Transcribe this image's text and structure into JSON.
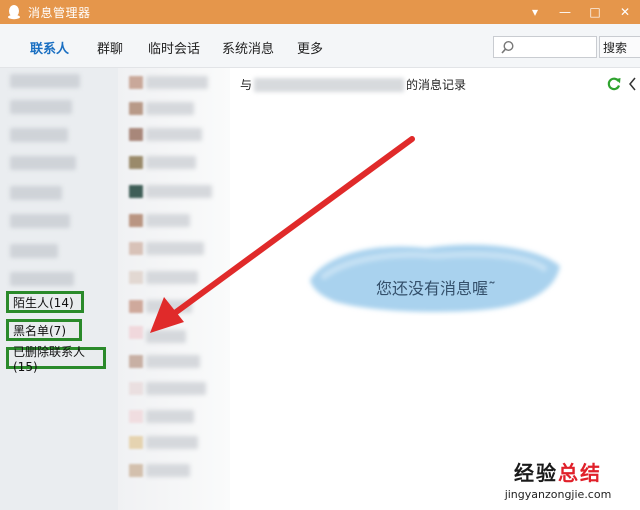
{
  "window": {
    "title": "消息管理器",
    "titlebar_color": "#e5964b",
    "controls": {
      "menu": "▾",
      "minimize": "—",
      "maximize": "□",
      "close": "✕"
    }
  },
  "tabs": [
    {
      "label": "联系人",
      "active": true
    },
    {
      "label": "群聊",
      "active": false
    },
    {
      "label": "临时会话",
      "active": false
    },
    {
      "label": "系统消息",
      "active": false
    },
    {
      "label": "更多",
      "active": false
    }
  ],
  "search": {
    "placeholder": "",
    "button_label": "搜索"
  },
  "groups": [
    {
      "label": "陌生人(14)"
    },
    {
      "label": "黑名单(7)"
    },
    {
      "label": "已删除联系人(15)"
    }
  ],
  "record_header": {
    "prefix": "与",
    "suffix": "的消息记录"
  },
  "empty_message": "您还没有消息喔˜",
  "annotation": {
    "arrow_color": "#e02a2a",
    "highlight_color": "#2a8a2a"
  },
  "watermark": {
    "text_prefix": "经验",
    "text_accent": "总结",
    "url": "jingyanzongjie.com"
  }
}
